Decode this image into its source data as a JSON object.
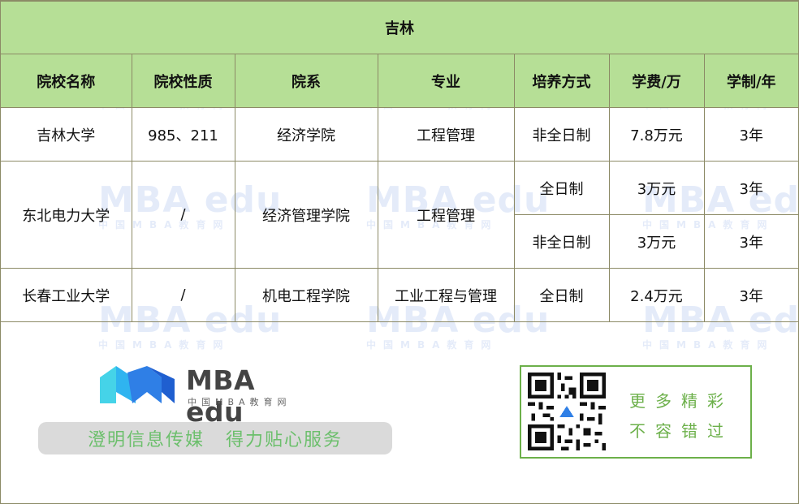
{
  "table": {
    "title": "吉林",
    "headers": [
      "院校名称",
      "院校性质",
      "院系",
      "专业",
      "培养方式",
      "学费/万",
      "学制/年"
    ],
    "rows": [
      {
        "school": "吉林大学",
        "nature": "985、211",
        "department": "经济学院",
        "major": "工程管理",
        "programs": [
          {
            "mode": "非全日制",
            "fee": "7.8万元",
            "years": "3年"
          }
        ]
      },
      {
        "school": "东北电力大学",
        "nature": "/",
        "department": "经济管理学院",
        "major": "工程管理",
        "programs": [
          {
            "mode": "全日制",
            "fee": "3万元",
            "years": "3年"
          },
          {
            "mode": "非全日制",
            "fee": "3万元",
            "years": "3年"
          }
        ]
      },
      {
        "school": "长春工业大学",
        "nature": "/",
        "department": "机电工程学院",
        "major": "工业工程与管理",
        "programs": [
          {
            "mode": "全日制",
            "fee": "2.4万元",
            "years": "3年"
          }
        ]
      }
    ]
  },
  "watermark": {
    "main": "MBA edu",
    "sub": "中国MBA教育网"
  },
  "footer": {
    "logo_name": "MBA edu",
    "logo_sub": "中国MBA教育网",
    "slogan": [
      "澄明信息传媒",
      "得力贴心服务"
    ],
    "qr_text": [
      "更多精彩",
      "不容错过"
    ]
  },
  "colors": {
    "header_bg": "#b6df96",
    "border": "#8c8a66",
    "accent_green": "#6cb04a",
    "logo_blue": "#2f7fe6"
  }
}
